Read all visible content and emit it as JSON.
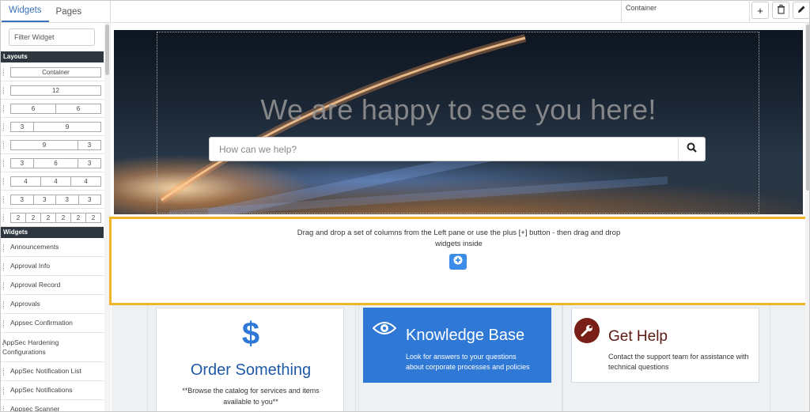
{
  "left_pane": {
    "tabs": [
      {
        "label": "Widgets",
        "active": true
      },
      {
        "label": "Pages",
        "active": false
      }
    ],
    "filter_placeholder": "Filter Widget",
    "layouts_header": "Layouts",
    "layouts": [
      [
        "Container"
      ],
      [
        "12"
      ],
      [
        "6",
        "6"
      ],
      [
        "3",
        "9"
      ],
      [
        "9",
        "3"
      ],
      [
        "3",
        "6",
        "3"
      ],
      [
        "4",
        "4",
        "4"
      ],
      [
        "3",
        "3",
        "3",
        "3"
      ],
      [
        "2",
        "2",
        "2",
        "2",
        "2",
        "2"
      ]
    ],
    "widgets_header": "Widgets",
    "widgets": [
      "Announcements",
      "Approval Info",
      "Approval Record",
      "Approvals",
      "Appsec Confirmation",
      "AppSec Hardening Configurations",
      "AppSec Notification List",
      "AppSec Notifications",
      "Appsec Scanner"
    ]
  },
  "top_bar": {
    "container_label": "Container",
    "buttons": [
      {
        "name": "add-button",
        "icon": "plus-icon",
        "glyph": "+"
      },
      {
        "name": "delete-button",
        "icon": "trash-icon",
        "glyph": "🗑"
      },
      {
        "name": "edit-button",
        "icon": "pencil-icon",
        "glyph": "✎"
      }
    ]
  },
  "hero": {
    "title": "We are happy to see you here!",
    "search_placeholder": "How can we help?"
  },
  "dropzone": {
    "text_line1": "Drag and drop a set of columns from the Left pane or use the plus [+] button - then drag and drop",
    "text_line2": "widgets inside",
    "highlight_color": "#f0b429"
  },
  "cards": {
    "order": {
      "icon": "$",
      "title": "Order Something",
      "desc_line1": "**Browse the catalog for services and items",
      "desc_line2": "available to you**"
    },
    "knowledge": {
      "title": "Knowledge Base",
      "desc_line1": "Look for answers to your questions",
      "desc_line2": "about corporate processes and policies",
      "color": "#2f78d6"
    },
    "help": {
      "title": "Get Help",
      "desc_line1": "Contact the support team for assistance with",
      "desc_line2": "technical questions",
      "color": "#7a1f17"
    }
  }
}
